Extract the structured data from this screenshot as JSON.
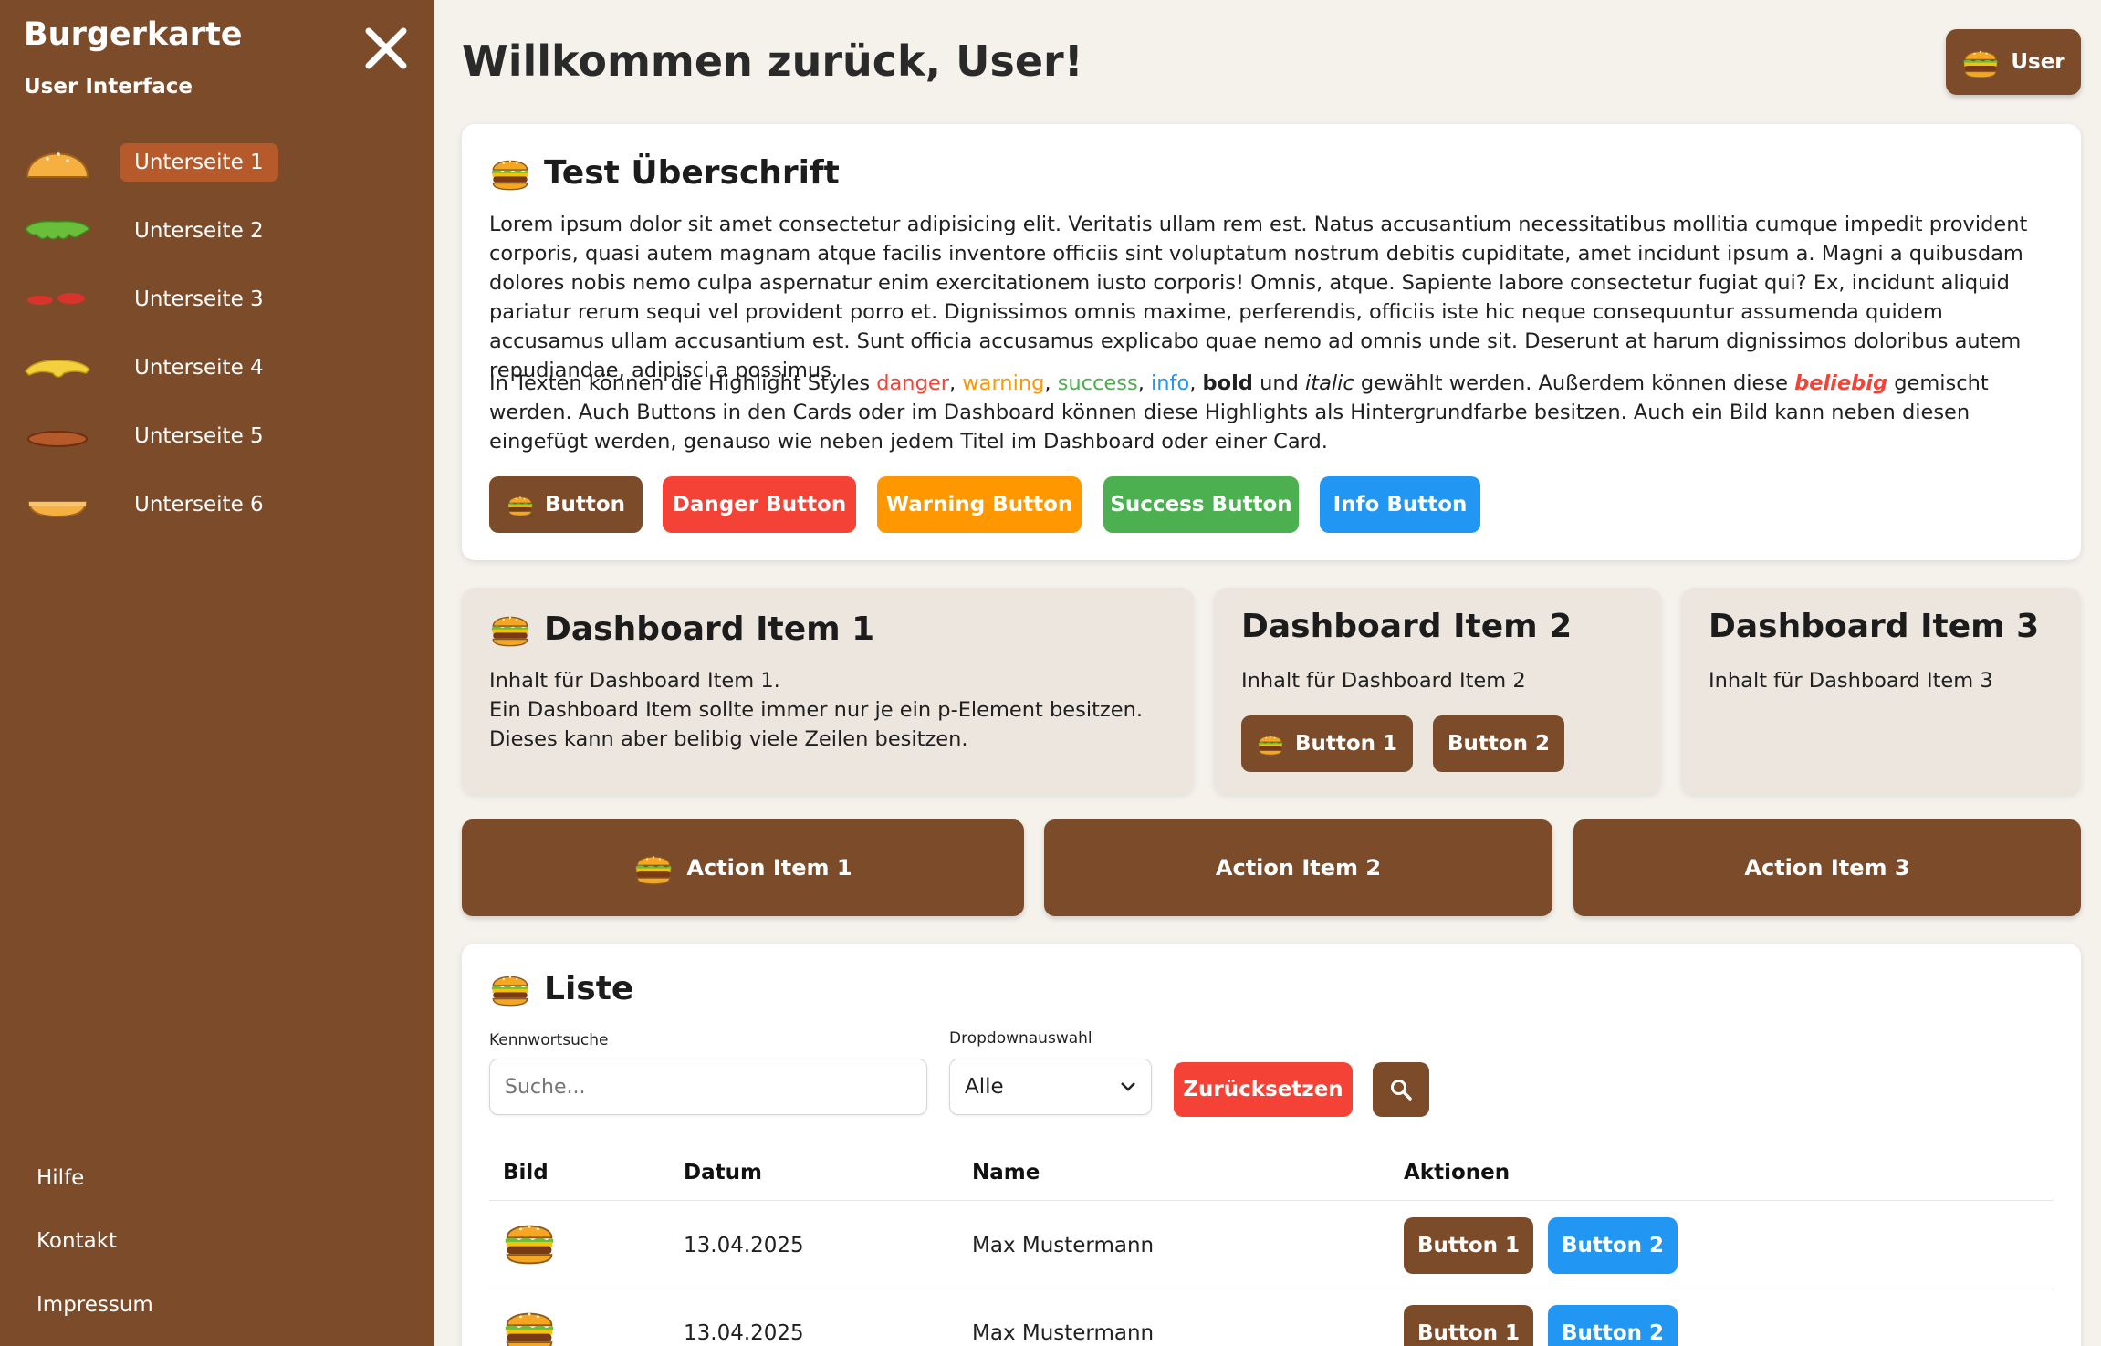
{
  "sidebar": {
    "title": "Burgerkarte",
    "subtitle": "User Interface",
    "items": [
      {
        "label": "Unterseite 1",
        "icon": "bun-top-icon"
      },
      {
        "label": "Unterseite 2",
        "icon": "lettuce-icon"
      },
      {
        "label": "Unterseite 3",
        "icon": "tomato-icon"
      },
      {
        "label": "Unterseite 4",
        "icon": "cheese-icon"
      },
      {
        "label": "Unterseite 5",
        "icon": "patty-icon"
      },
      {
        "label": "Unterseite 6",
        "icon": "bun-bottom-icon"
      }
    ],
    "footer": [
      "Hilfe",
      "Kontakt",
      "Impressum"
    ]
  },
  "header": {
    "title": "Willkommen zurück, User!",
    "user_label": "User"
  },
  "intro": {
    "title": "Test Überschrift",
    "paragraph1": "Lorem ipsum dolor sit amet consectetur adipisicing elit. Veritatis ullam rem est. Natus accusantium necessitatibus mollitia cumque impedit provident corporis, quasi autem magnam atque facilis inventore officiis sint voluptatum nostrum debitis cupiditate, amet incidunt ipsum a. Magni a quibusdam dolores nobis nemo culpa aspernatur enim exercitationem iusto corporis! Omnis, atque. Sapiente labore consectetur fugiat qui? Ex, incidunt aliquid pariatur rerum sequi vel provident porro et. Dignissimos omnis maxime, perferendis, officiis iste hic neque consequuntur assumenda quidem accusamus ullam accusantium est. Sunt officia accusamus explicabo quae nemo ad omnis unde sit. Deserunt at harum dignissimos doloribus autem repudiandae, adipisci a possimus.",
    "p2": {
      "t1": "In Texten können die Highlight Styles ",
      "danger": "danger",
      "sep1": ", ",
      "warning": "warning",
      "sep2": ", ",
      "success": "success",
      "sep3": ", ",
      "info": "info",
      "sep4": ", ",
      "bold": "bold",
      "t2": " und ",
      "italic": "italic",
      "t3": " gewählt werden. Außerdem können diese ",
      "mix": "beliebig",
      "t4": " gemischt werden. Auch Buttons in den Cards oder im Dashboard können diese Highlights als Hintergrundfarbe besitzen. Auch ein Bild kann neben diesen eingefügt werden, genauso wie neben jedem Titel im Dashboard oder einer Card."
    },
    "buttons": {
      "default": "Button",
      "danger": "Danger Button",
      "warning": "Warning Button",
      "success": "Success Button",
      "info": "Info Button"
    }
  },
  "dashboard": [
    {
      "title": "Dashboard Item 1",
      "lines": [
        "Inhalt für Dashboard Item 1.",
        "Ein Dashboard Item sollte immer nur je ein p-Element besitzen.",
        "Dieses kann aber belibig viele Zeilen besitzen."
      ]
    },
    {
      "title": "Dashboard Item 2",
      "text": "Inhalt für Dashboard Item 2",
      "button1": "Button 1",
      "button2": "Button 2"
    },
    {
      "title": "Dashboard Item 3",
      "text": "Inhalt für Dashboard Item 3"
    }
  ],
  "actions": [
    "Action Item 1",
    "Action Item 2",
    "Action Item 3"
  ],
  "list": {
    "title": "Liste",
    "search_label": "Kennwortsuche",
    "search_placeholder": "Suche...",
    "dropdown_label": "Dropdownauswahl",
    "dropdown_value": "Alle",
    "reset_label": "Zurücksetzen",
    "columns": [
      "Bild",
      "Datum",
      "Name",
      "Aktionen"
    ],
    "rows": [
      {
        "date": "13.04.2025",
        "name": "Max Mustermann",
        "button1": "Button 1",
        "button2": "Button 2"
      },
      {
        "date": "13.04.2025",
        "name": "Max Mustermann",
        "button1": "Button 1",
        "button2": "Button 2"
      }
    ]
  },
  "colors": {
    "brown": "#7b4b2a",
    "active": "#b65a2b",
    "danger": "#f44336",
    "warning": "#ff9800",
    "success": "#4caf50",
    "info": "#2196f3"
  }
}
